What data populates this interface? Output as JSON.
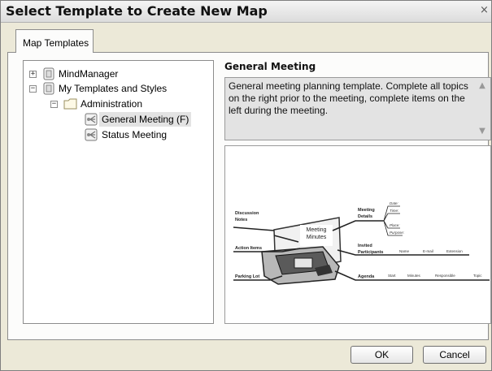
{
  "window": {
    "title": "Select Template to Create New Map",
    "close_glyph": "×"
  },
  "tabs": [
    {
      "label": "Map Templates",
      "active": true
    }
  ],
  "tree": {
    "items": [
      {
        "label": "MindManager",
        "expander": "+",
        "icon": "template-library-icon"
      },
      {
        "label": "My Templates and Styles",
        "expander": "−",
        "icon": "template-library-icon"
      },
      {
        "label": "Administration",
        "expander": "−",
        "icon": "folder-icon"
      },
      {
        "label": "General Meeting  (F)",
        "icon": "map-template-icon",
        "selected": true
      },
      {
        "label": "Status Meeting",
        "icon": "map-template-icon"
      }
    ]
  },
  "detail": {
    "title": "General Meeting",
    "description": "General meeting planning template. Complete all topics on the right prior to the meeting, complete items on the left during the meeting."
  },
  "preview": {
    "central": "Meeting\nMinutes",
    "left_topics": [
      "Discussion Notes",
      "Action Items",
      "Parking Lot"
    ],
    "right_topics": [
      "Meeting Details",
      "Invited Participants",
      "Agenda"
    ],
    "details_subtopics": [
      "Date:",
      "Time:",
      "Place:",
      "Purpose:"
    ],
    "participants_subtopics": [
      "Name",
      "E-mail",
      "Extension"
    ],
    "agenda_subtopics": [
      "Start",
      "Minutes",
      "Responsible",
      "Topic"
    ]
  },
  "buttons": {
    "ok": "OK",
    "cancel": "Cancel"
  },
  "colors": {
    "dialog_bg": "#ece9d8",
    "selection_bg": "#e3e3e3"
  }
}
